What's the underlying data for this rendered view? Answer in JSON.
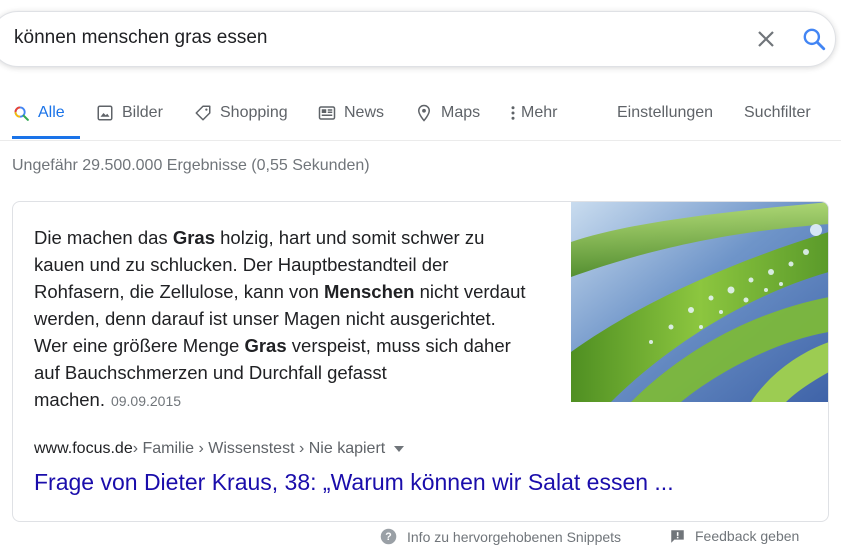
{
  "search": {
    "query": "können menschen gras essen"
  },
  "tabs": [
    {
      "label": "Alle",
      "icon": "search-icon",
      "active": true
    },
    {
      "label": "Bilder",
      "icon": "image-icon"
    },
    {
      "label": "Shopping",
      "icon": "tag-icon"
    },
    {
      "label": "News",
      "icon": "newspaper-icon"
    },
    {
      "label": "Maps",
      "icon": "map-pin-icon"
    },
    {
      "label": "Mehr",
      "icon": "more-vert-icon"
    }
  ],
  "tools": {
    "settings": "Einstellungen",
    "filter": "Suchfilter"
  },
  "result_stats": "Ungefähr 29.500.000 Ergebnisse (0,55 Sekunden)",
  "snippet": {
    "segments": [
      {
        "text": "Die machen das ",
        "bold": false
      },
      {
        "text": "Gras",
        "bold": true
      },
      {
        "text": " holzig, hart und somit schwer zu kauen und zu schlucken. Der Hauptbestandteil der Rohfasern, die Zellulose, kann von ",
        "bold": false
      },
      {
        "text": "Menschen",
        "bold": true
      },
      {
        "text": " nicht verdaut werden, denn darauf ist unser Magen nicht ausgerichtet. Wer eine größere Menge ",
        "bold": false
      },
      {
        "text": "Gras",
        "bold": true
      },
      {
        "text": " verspeist, muss sich daher auf Bauchschmerzen und Durchfall gefasst machen.",
        "bold": false
      }
    ],
    "date": "09.09.2015",
    "breadcrumb": {
      "domain": "www.focus.de",
      "path": " › Familie › Wissenstest › Nie kapiert"
    },
    "title": "Frage von Dieter Kraus, 38: „Warum können wir Salat essen ...",
    "image_description_icon": "grass-with-dew-image"
  },
  "footer": {
    "info": "Info zu hervorgehobenen Snippets",
    "feedback": "Feedback geben"
  },
  "colors": {
    "link": "#1a0dab",
    "active_tab": "#1a73e8",
    "muted": "#70757a"
  }
}
